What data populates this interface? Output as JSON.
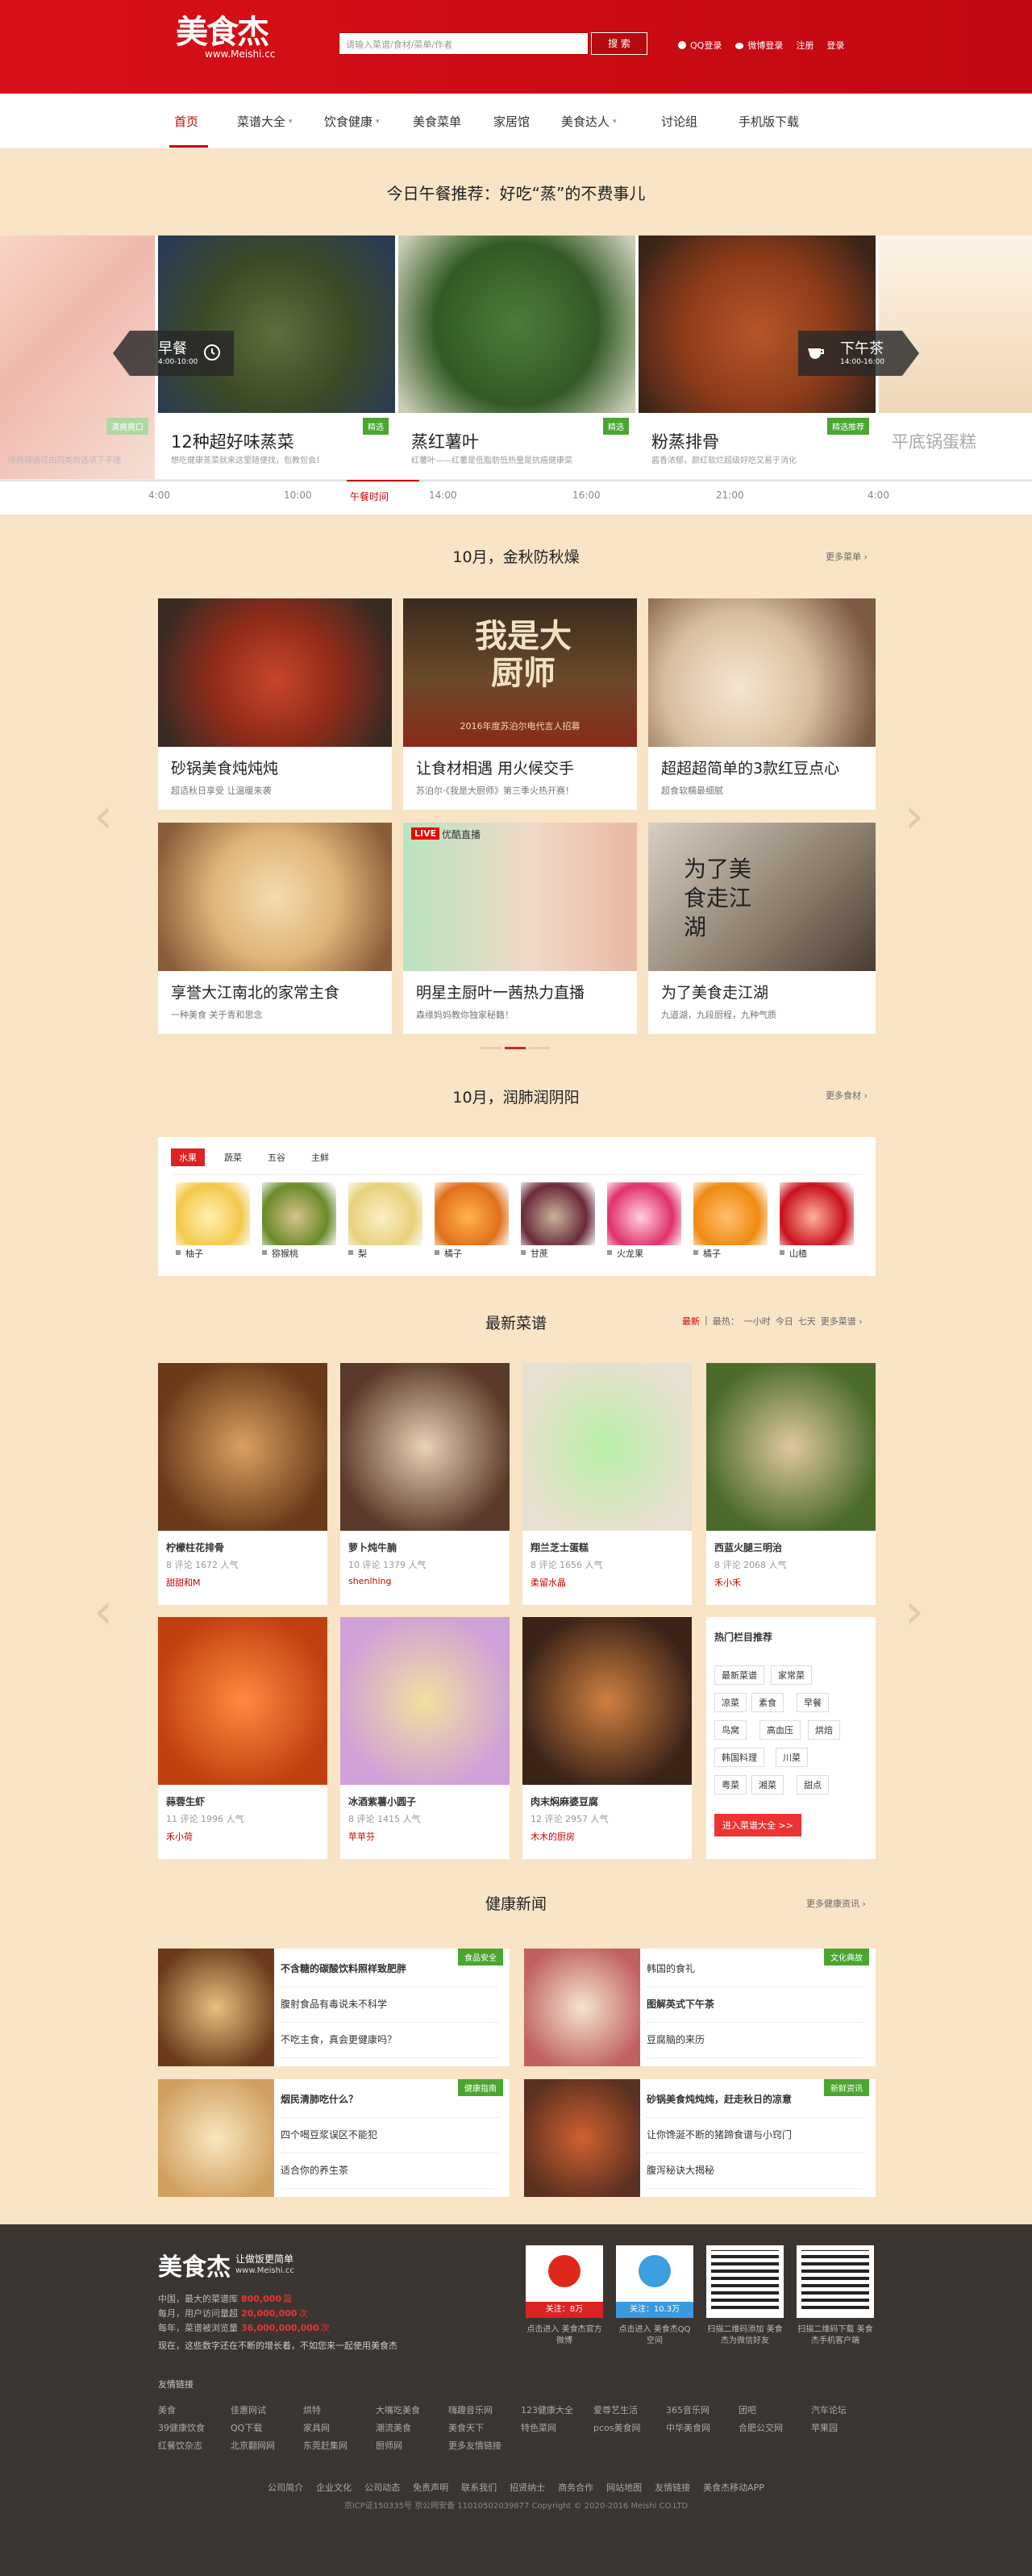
{
  "header": {
    "logo_text": "美食杰",
    "logo_url": "www.Meishi.cc",
    "search_placeholder": "请输入菜谱/食材/菜单/作者",
    "search_button": "搜 索",
    "qq_login": "QQ登录",
    "weibo_login": "微博登录",
    "register": "注册",
    "login": "登录"
  },
  "nav": {
    "items": [
      "首页",
      "菜谱大全",
      "饮食健康",
      "美食菜单",
      "家居馆",
      "美食达人",
      "讨论组",
      "手机版下载"
    ]
  },
  "lunch": {
    "title": "今日午餐推荐：好吃“蒸”的不费事儿",
    "breakfast_label": "早餐",
    "breakfast_time": "4:00-10:00",
    "afternoon_label": "下午茶",
    "afternoon_time": "14:00-16:00",
    "slides": [
      {
        "title": "12种超好味蒸菜",
        "sub": "想吃健康蒸菜就来这里随便找，包教包会！",
        "tag": "精选"
      },
      {
        "title": "蒸红薯叶",
        "sub": "红薯叶——红薯是低脂肪低热量是抗癌健康菜",
        "tag": "精选"
      },
      {
        "title": "粉蒸排骨",
        "sub": "酱香浓郁，颜红软烂超级好吃又易于消化",
        "tag": "精选推荐"
      },
      {
        "title": "平底锅蛋糕",
        "sub": "",
        "tag": ""
      }
    ],
    "left_partial_tag": "清爽爽口",
    "left_partial_sub": "冷热调适可由同类的选项下不理",
    "timeline": [
      "4:00",
      "10:00",
      "午餐时间",
      "14:00",
      "16:00",
      "21:00",
      "4:00"
    ]
  },
  "autumn": {
    "title": "10月，金秋防秋燥",
    "more": "更多菜单",
    "cards": [
      {
        "title": "砂锅美食炖炖炖",
        "sub": "超适秋日享受 让温暖来袭"
      },
      {
        "title": "让食材相遇 用火候交手",
        "sub": "苏泊尔·《我是大厨师》第三季火热开赛！"
      },
      {
        "title": "超超超简单的3款红豆点心",
        "sub": "超食软糯最细腻"
      },
      {
        "title": "享誉大江南北的家常主食",
        "sub": "一种美食 关于青和思念"
      },
      {
        "title": "明星主厨叶一茜热力直播",
        "sub": "森缘妈妈教你独家秘籍！"
      },
      {
        "title": "为了美食走江湖",
        "sub": "九道湖，九段厨程，九种气质"
      }
    ],
    "banner_text1": "我是大厨师",
    "banner_text2": "2016年度苏泊尔电代言人招募",
    "live_text": "优酷直播",
    "live_badge": "LIVE",
    "jianghu_text": "为了美食走江湖"
  },
  "moisten": {
    "title": "10月，润肺润阴阳",
    "more": "更多食材",
    "tabs": [
      "水果",
      "蔬菜",
      "五谷",
      "主鲜"
    ],
    "items": [
      "柚子",
      "猕猴桃",
      "梨",
      "橘子",
      "甘蔗",
      "火龙果",
      "橘子",
      "山楂"
    ]
  },
  "latest": {
    "title": "最新菜谱",
    "filter": [
      "最新",
      "最热：",
      "一小时",
      "今日",
      "七天",
      "更多菜谱"
    ],
    "recipes": [
      {
        "name": "柠檬柱花排骨",
        "stats": "8 评论  1672 人气",
        "author": "甜甜和M"
      },
      {
        "name": "萝卜炖牛腩",
        "stats": "10 评论  1379 人气",
        "author": "shenlhing"
      },
      {
        "name": "翔兰芝士蛋糕",
        "stats": "8 评论  1656 人气",
        "author": "柔留水晶"
      },
      {
        "name": "西蓝火腿三明治",
        "stats": "8 评论  2068 人气",
        "author": "禾小禾"
      },
      {
        "name": "蒜蓉生虾",
        "stats": "11 评论  1996 人气",
        "author": "禾小荷"
      },
      {
        "name": "冰酒紫薯小圆子",
        "stats": "8 评论  1415 人气",
        "author": "苹苹芬"
      },
      {
        "name": "肉末焖麻婆豆腐",
        "stats": "12 评论  2957 人气",
        "author": "木木的厨房"
      }
    ],
    "hot_title": "热门栏目推荐",
    "hot_chips": [
      "最新菜谱",
      "家常菜",
      "凉菜",
      "素食",
      "早餐",
      "鸟窝",
      "高血压",
      "烘焙",
      "韩国料理",
      "川菜",
      "粤菜",
      "湘菜",
      "甜点"
    ],
    "hot_button": "进入菜谱大全 >>"
  },
  "health": {
    "title": "健康新闻",
    "more": "更多健康资讯",
    "blocks": [
      {
        "tag": "食品安全",
        "rows": [
          "不含糖的碳酸饮料照样致肥胖",
          "腹射食品有毒说未不科学",
          "不吃主食，真会更健康吗？"
        ]
      },
      {
        "tag": "文化典故",
        "rows": [
          "韩国的食礼",
          "图解英式下午茶",
          "豆腐脑的来历"
        ]
      },
      {
        "tag": "健康指南",
        "rows": [
          "烟民清肺吃什么？",
          "四个喝豆浆误区不能犯",
          "适合你的养生茶"
        ]
      },
      {
        "tag": "新鲜资讯",
        "rows": [
          "砂锅美食炖炖炖，赶走秋日的凉意",
          "让你馋涎不断的猪蹄食谱与小窍门",
          "腹泻秘诀大揭秘"
        ]
      }
    ]
  },
  "footer": {
    "slogan": "让做饭更简单",
    "url": "www.Meishi.cc",
    "stats": [
      {
        "label": "中国，最大的菜谱库",
        "value": "800,000",
        "unit": "篇"
      },
      {
        "label": "每月，用户访问量超",
        "value": "20,000,000",
        "unit": "次"
      },
      {
        "label": "每年，菜谱被浏览量",
        "value": "36,000,000,000",
        "unit": "次"
      }
    ],
    "note": "现在，这些数字还在不断的增长着，不如您来一起使用美食杰",
    "social": [
      {
        "badge": "关注：8万",
        "cap": "点击进入 美食杰官方微博"
      },
      {
        "badge": "关注：10.3万",
        "cap": "点击进入 美食杰QQ空间"
      },
      {
        "badge": "",
        "cap": "扫描二维码添加 美食杰为微信好友"
      },
      {
        "badge": "",
        "cap": "扫描二维码下载 美食杰手机客户端"
      }
    ],
    "links_title": "友情链接",
    "links": [
      "美食",
      "佳惠网试",
      "烘特",
      "大嘴吃美食",
      "嗨趣音乐网",
      "123健康大全",
      "爱尊艺生活",
      "365音乐网",
      "团吧",
      "汽车论坛",
      "39健康饮食",
      "QQ下载",
      "家具网",
      "潮流美食",
      "美食天下",
      "特色菜网",
      "pcos美食网",
      "中华美食网",
      "合肥公交网",
      "苹果园",
      "红餐饮杂志",
      "北京翻网网",
      "东莞赶集网",
      "厨师网",
      "更多友情链接"
    ],
    "bottom_links": [
      "公司简介",
      "企业文化",
      "公司动态",
      "免责声明",
      "联系我们",
      "招贤纳士",
      "商务合作",
      "网站地图",
      "友情链接",
      "美食杰移动APP"
    ],
    "copyright": "京ICP证150335号 京公网安备 11010502039877 Copyright © 2020-2016 Meishi CO.LTD"
  }
}
